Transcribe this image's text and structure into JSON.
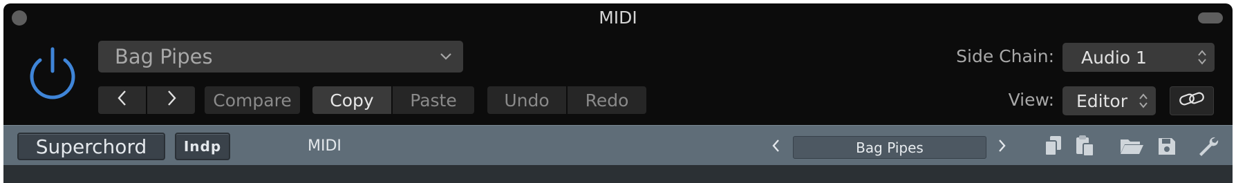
{
  "window": {
    "title": "MIDI"
  },
  "header": {
    "preset_name": "Bag Pipes",
    "nav": {
      "prev_icon": "chevron-left-icon",
      "next_icon": "chevron-right-icon"
    },
    "buttons": {
      "compare": "Compare",
      "copy": "Copy",
      "paste": "Paste",
      "undo": "Undo",
      "redo": "Redo"
    },
    "side_chain": {
      "label": "Side Chain:",
      "value": "Audio 1"
    },
    "view": {
      "label": "View:",
      "value": "Editor"
    },
    "link_icon": "link-icon",
    "power_icon": "power-icon",
    "power_color": "#3f85d8"
  },
  "plugin_toolbar": {
    "name_button": "Superchord",
    "logo_text": "Indp",
    "category": "MIDI",
    "preset": "Bag Pipes",
    "icons": [
      "copy-icon",
      "paste-icon",
      "folder-open-icon",
      "save-icon",
      "wrench-icon"
    ]
  }
}
